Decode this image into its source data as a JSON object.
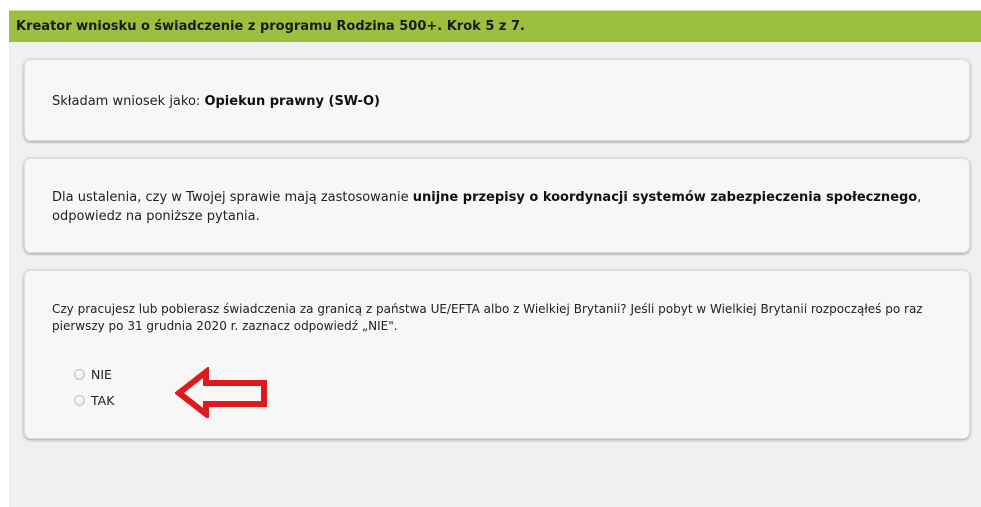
{
  "header": {
    "title": "Kreator wniosku o świadczenie z programu Rodzina 500+. Krok 5 z 7."
  },
  "applicant": {
    "prefix": "Składam wniosek jako: ",
    "value": "Opiekun prawny (SW-O)"
  },
  "info": {
    "part1": "Dla ustalenia, czy w Twojej sprawie mają zastosowanie ",
    "bold": "unijne przepisy o koordynacji systemów zabezpieczenia społecznego",
    "part2": ", odpowiedz na poniższe pytania."
  },
  "question": {
    "text": "Czy pracujesz lub pobierasz świadczenia za granicą z państwa UE/EFTA albo z Wielkiej Brytanii? Jeśli pobyt w Wielkiej Brytanii rozpocząłeś po raz pierwszy po 31 grudnia 2020 r. zaznacz odpowiedź „NIE\".",
    "options": [
      "NIE",
      "TAK"
    ],
    "selected": null
  },
  "annotation": {
    "arrow_color": "#e0191c",
    "icon": "left-arrow-icon"
  }
}
